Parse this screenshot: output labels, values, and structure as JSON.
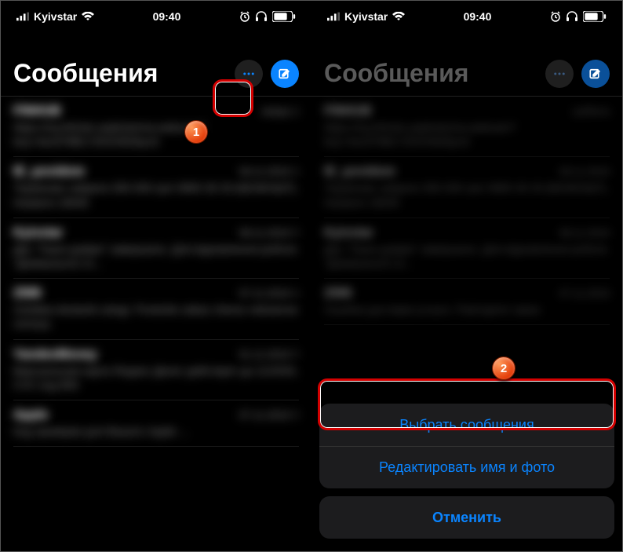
{
  "status": {
    "carrier": "Kyivstar",
    "time": "09:40"
  },
  "left": {
    "title": "Сообщения",
    "messages": [
      {
        "name": "FINHUB",
        "date": "вчера",
        "preview": "https://my.finhub.ua/photo/na-webcam?key=4a1978BLY2K0VB26yci2"
      },
      {
        "name": "IE_povidom",
        "date": "09.11.2019",
        "preview": "Терміново забрати 350 000 грн! 0800 30 33 (БЕЗКОШТ). Назвати 18045"
      },
      {
        "name": "Kyivstar",
        "date": "08.11.2019",
        "preview": "Дію \"Тижні довіри\" завершено. Для відновлення роботи \"Домашнього Ін..."
      },
      {
        "name": "2586",
        "date": "07.11.2019",
        "preview": "Oshibka dostavki uslugi. Povtorite zakaz cherez nekotoroe vremya."
      },
      {
        "name": "YandexMoney",
        "date": "01.11.2019",
        "preview": "Виртуальная карта Яндекс Денег действует до 11/2020, CVC код 859"
      },
      {
        "name": "Apple",
        "date": "07.11.2019",
        "preview": "Код проверки для Вашего Apple ..."
      }
    ]
  },
  "right": {
    "title": "Сообщения",
    "messages": [
      {
        "name": "FINHUB",
        "date": "суббота",
        "preview": "https://my.finhub.ua/photo/na-webcam?key=4a1978BLY2K0VB26yci2"
      },
      {
        "name": "IE_povidom",
        "date": "09.11.2019",
        "preview": "Терміново забрати 350 000 грн! 0800 30 33 (БЕЗКОШТ). Назвати 18045"
      },
      {
        "name": "Kyivstar",
        "date": "08.11.2019",
        "preview": "Дію \"Тижні довіри\" завершено. Для відновлення роботи \"Домашнього Ін..."
      },
      {
        "name": "2586",
        "date": "07.11.2019",
        "preview": "Ошибка доставки услуги. Повторите заказ"
      }
    ],
    "sheet": {
      "select": "Выбрать сообщения",
      "edit": "Редактировать имя и фото",
      "cancel": "Отменить"
    }
  },
  "callouts": {
    "one": "1",
    "two": "2"
  }
}
